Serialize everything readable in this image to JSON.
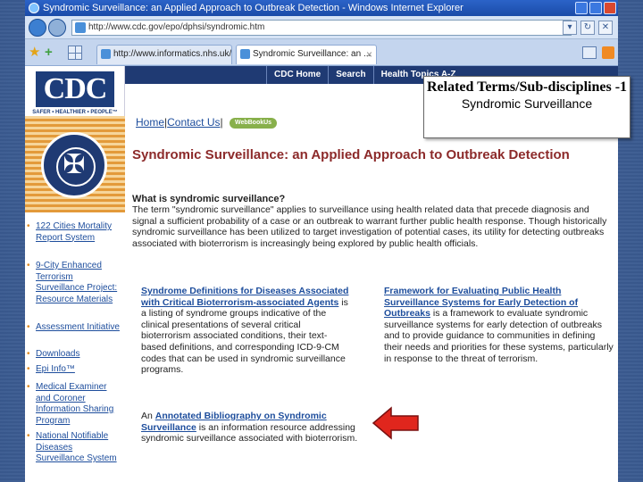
{
  "window": {
    "title": "Syndromic Surveillance: an Applied Approach to Outbreak Detection - Windows Internet Explorer"
  },
  "address": {
    "url": "http://www.cdc.gov/epo/dphsi/syndromic.htm"
  },
  "tabs": [
    {
      "label": "http://www.informatics.nhs.uk/d..."
    },
    {
      "label": "Syndromic Surveillance: an ..."
    }
  ],
  "site": {
    "logo": "CDC",
    "tagline": "SAFER • HEALTHIER • PEOPLE™",
    "nav": [
      "CDC Home",
      "Search",
      "Health Topics A-Z"
    ],
    "util_links": {
      "home": "Home",
      "contact": "Contact Us",
      "webbookus": "WebBookUs"
    }
  },
  "sidebar": {
    "items": [
      {
        "label": "122 Cities Mortality Report System"
      },
      {
        "label": "9-City Enhanced Terrorism Surveillance Project: Resource Materials"
      },
      {
        "label": "Assessment Initiative"
      },
      {
        "label": "Downloads"
      },
      {
        "label": "Epi Info™"
      },
      {
        "label": "Medical Examiner and Coroner Information Sharing Program"
      },
      {
        "label": "National Notifiable Diseases Surveillance System"
      }
    ]
  },
  "main": {
    "title": "Syndromic Surveillance: an Applied Approach to Outbreak Detection",
    "question": "What is syndromic surveillance?",
    "intro": "The term \"syndromic surveillance\" applies to surveillance using health related data that precede diagnosis and signal a sufficient probability of a case or an outbreak to warrant further public health response. Though historically syndromic surveillance has been utilized to target investigation of potential cases, its utility for detecting outbreaks associated with bioterrorism is increasingly being explored by public health officials.",
    "left_link": "Syndrome Definitions for Diseases Associated with Critical Bioterrorism-associated Agents",
    "left_text": " is a listing of syndrome groups indicative of the clinical presentations of several critical bioterrorism associated conditions, their text-based definitions, and corresponding ICD-9-CM codes that can be used in syndromic surveillance programs.",
    "right_link": "Framework for Evaluating Public Health Surveillance Systems for Early Detection of Outbreaks",
    "right_text": " is a framework to evaluate syndromic surveillance systems for early detection of outbreaks and to provide guidance to communities in defining their needs and priorities for these systems, particularly in response to the threat of terrorism.",
    "biblio_pre": "An ",
    "biblio_link": "Annotated Bibliography on Syndromic Surveillance",
    "biblio_text": " is an information resource addressing syndromic surveillance associated with bioterrorism."
  },
  "callout": {
    "title": "Related Terms/Sub-disciplines -1",
    "subtitle": "Syndromic Surveillance"
  },
  "colors": {
    "slide_bg": "#3e5f96",
    "cdc_navy": "#1f3a73",
    "link": "#1d4d9c",
    "title_red": "#8c2a2a",
    "arrow": "#e0261d"
  }
}
